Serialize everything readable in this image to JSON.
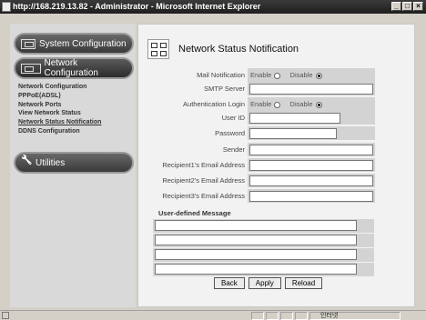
{
  "window": {
    "title": "http://168.219.13.82 - Administrator - Microsoft Internet Explorer",
    "minimize": "_",
    "maximize": "□",
    "close": "×"
  },
  "sidebar": {
    "system_config": "System Configuration",
    "network_config": "Network Configuration",
    "utilities": "Utilities",
    "items": [
      {
        "label": "Network Configuration"
      },
      {
        "label": "PPPoE(ADSL)"
      },
      {
        "label": "Network Ports"
      },
      {
        "label": "View Network Status"
      },
      {
        "label": "Network Status Notification",
        "active": true
      },
      {
        "label": "DDNS Configuration"
      }
    ]
  },
  "main": {
    "title": "Network Status Notification",
    "mail_notification": {
      "label": "Mail Notification",
      "enable": "Enable",
      "disable": "Disable",
      "selected": "Disable"
    },
    "smtp_server": {
      "label": "SMTP Server",
      "value": ""
    },
    "auth_login": {
      "label": "Authentication Login",
      "enable": "Enable",
      "disable": "Disable",
      "selected": "Disable"
    },
    "user_id": {
      "label": "User ID",
      "value": ""
    },
    "password": {
      "label": "Password",
      "value": ""
    },
    "sender": {
      "label": "Sender",
      "value": ""
    },
    "recipient1": {
      "label": "Recipient1's Email Address",
      "value": ""
    },
    "recipient2": {
      "label": "Recipient2's Email Address",
      "value": ""
    },
    "recipient3": {
      "label": "Recipient3's Email Address",
      "value": ""
    },
    "user_defined_message": {
      "label": "User-defined Message",
      "lines": [
        "",
        "",
        "",
        ""
      ]
    },
    "buttons": {
      "back": "Back",
      "apply": "Apply",
      "reload": "Reload"
    }
  },
  "statusbar": {
    "zone": "인터넷"
  }
}
